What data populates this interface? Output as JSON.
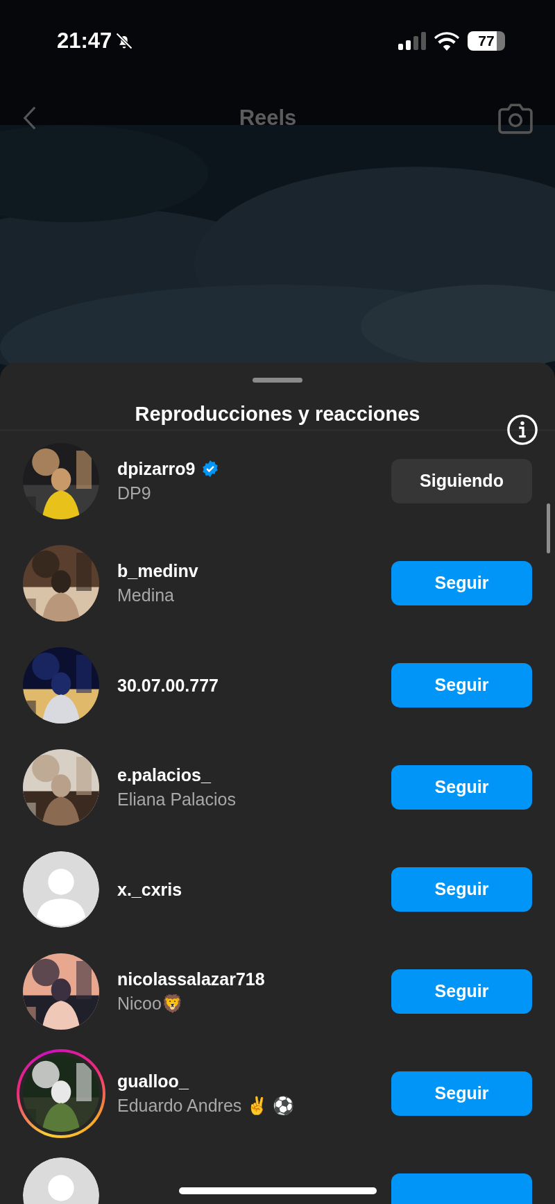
{
  "status_bar": {
    "time": "21:47",
    "silent": true,
    "battery": "77"
  },
  "nav": {
    "title": "Reels"
  },
  "sheet": {
    "title": "Reproducciones y reacciones",
    "rows": [
      {
        "kind": "picture",
        "story_ring": false,
        "username": "dpizarro9",
        "verified": true,
        "name": "DP9",
        "button": {
          "label": "Siguiendo",
          "kind": "following"
        }
      },
      {
        "kind": "picture",
        "story_ring": false,
        "username": "b_medinv",
        "verified": false,
        "name": "Medina",
        "button": {
          "label": "Seguir",
          "kind": "follow"
        }
      },
      {
        "kind": "picture",
        "story_ring": false,
        "username": "30.07.00.777",
        "verified": false,
        "button": {
          "label": "Seguir",
          "kind": "follow"
        }
      },
      {
        "kind": "picture",
        "story_ring": false,
        "username": "e.palacios_",
        "verified": false,
        "name": "Eliana Palacios",
        "button": {
          "label": "Seguir",
          "kind": "follow"
        }
      },
      {
        "kind": "default",
        "story_ring": false,
        "username": "x._cxris",
        "verified": false,
        "button": {
          "label": "Seguir",
          "kind": "follow"
        }
      },
      {
        "kind": "picture",
        "story_ring": false,
        "username": "nicolassalazar718",
        "verified": false,
        "name": "Nicoo🦁",
        "button": {
          "label": "Seguir",
          "kind": "follow"
        }
      },
      {
        "kind": "picture",
        "story_ring": true,
        "username": "gualloo_",
        "verified": false,
        "name": "Eduardo Andres ✌️ ⚽️",
        "button": {
          "label": "Seguir",
          "kind": "follow"
        }
      },
      {
        "kind": "default",
        "button": {
          "kind": "follow"
        }
      }
    ]
  }
}
